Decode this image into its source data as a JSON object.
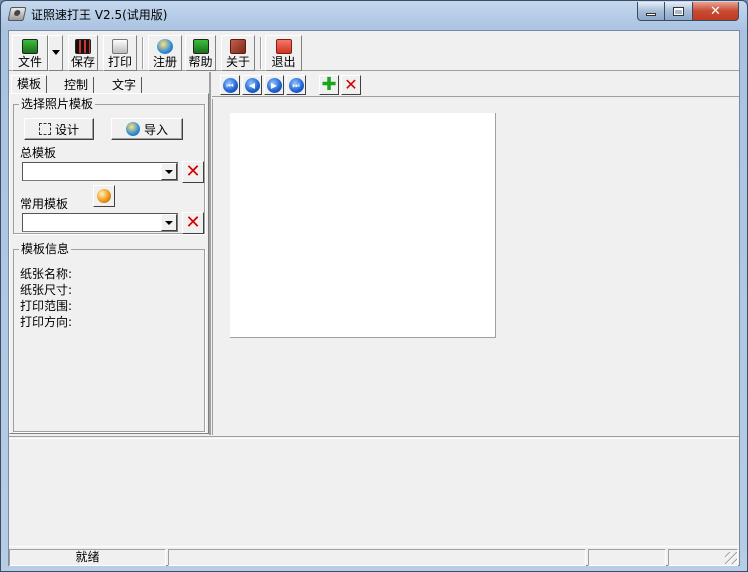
{
  "window": {
    "title": "证照速打王 V2.5(试用版)"
  },
  "toolbar": {
    "file_label": "文件",
    "save_label": "保存",
    "print_label": "打印",
    "register_label": "注册",
    "help_label": "帮助",
    "about_label": "关于",
    "exit_label": "退出"
  },
  "tabs": [
    "模板",
    "控制",
    "文字"
  ],
  "template_panel": {
    "group_title": "选择照片模板",
    "design_label": "设计",
    "import_label": "导入",
    "master_label": "总模板",
    "master_value": "",
    "common_label": "常用模板",
    "common_value": ""
  },
  "template_info": {
    "group_title": "模板信息",
    "paper_name": "纸张名称:",
    "paper_size": "纸张尺寸:",
    "print_range": "打印范围:",
    "print_orientation": "打印方向:"
  },
  "status": {
    "ready": "就绪"
  },
  "colors": {
    "titlebar": "#b7cde6",
    "close": "#c84a32",
    "nav_blue": "#1d5fcf",
    "add_green": "#1aa41a",
    "delete_red": "#d40000"
  },
  "icons": {
    "file": "camera-icon",
    "save": "film-icon",
    "print": "printer-icon",
    "register": "globe-icon",
    "help": "camera-help-icon",
    "about": "box-icon",
    "exit": "power-icon"
  }
}
